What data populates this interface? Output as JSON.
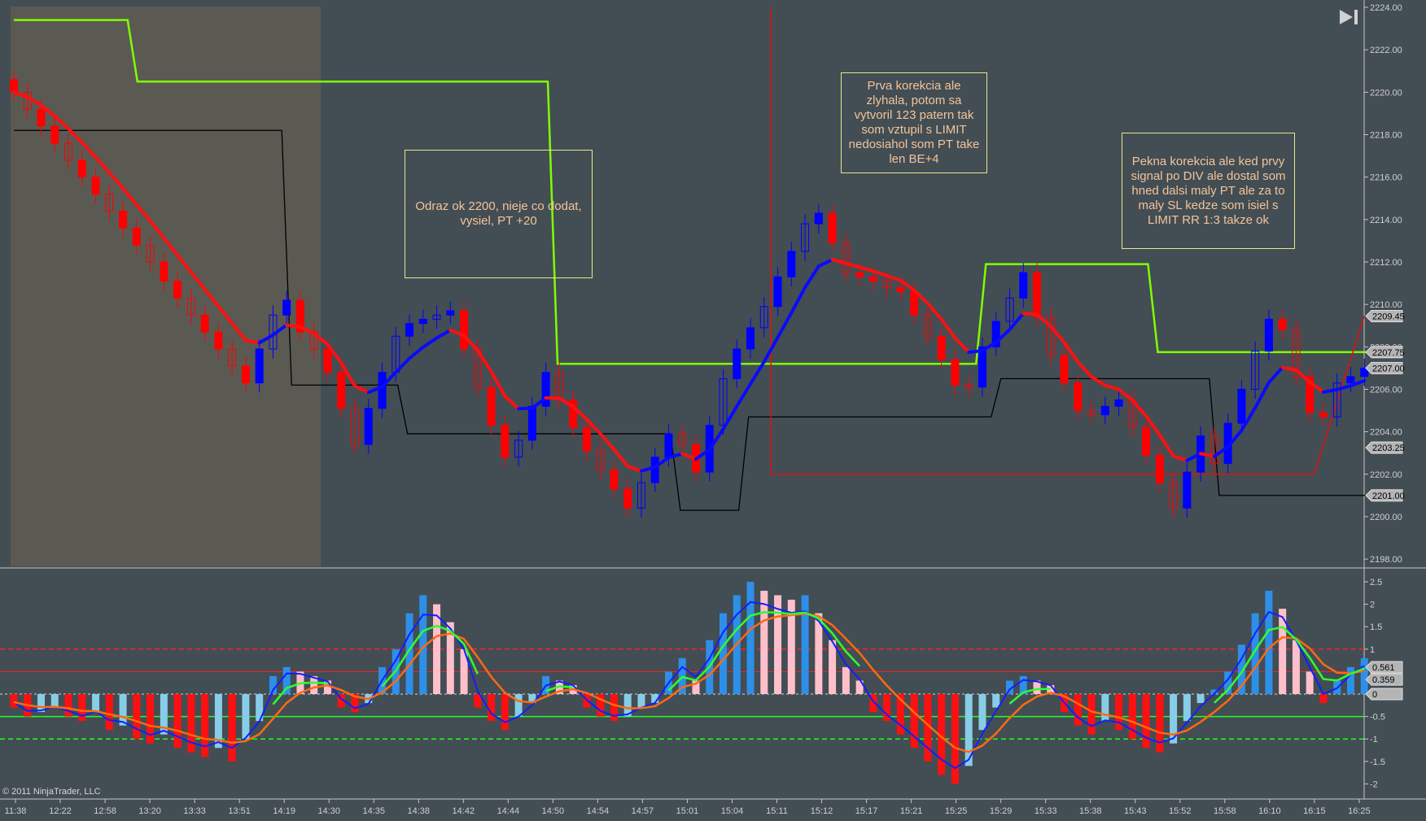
{
  "app": {
    "copyright": "© 2011 NinjaTrader, LLC",
    "skip_icon": "skip-to-end-icon"
  },
  "colors": {
    "background": "#434d54",
    "session_shade": "#5a5a53",
    "up_bar": "#0000ff",
    "down_bar": "#ff0000",
    "stop_line": "#7fff00",
    "note_text": "#f2c49a",
    "note_border": "#e6e88c"
  },
  "annotations": [
    {
      "text": "Odraz ok 2200, nieje co dodat, vysiel, PT +20"
    },
    {
      "text": "Prva korekcia ale zlyhala, potom sa vytvoril 123 patern tak som vztupil s LIMIT nedosiahol som PT take len BE+4"
    },
    {
      "text": "Pekna korekcia ale ked prvy signal po DIV ale dostal som hned dalsi maly PT ale za to maly SL kedze som isiel s LIMIT RR 1:3 takze ok"
    }
  ],
  "chart_data": [
    {
      "type": "candlestick",
      "ylim": [
        2198,
        2224
      ],
      "y_ticks": [
        "2224.00",
        "2222.00",
        "2220.00",
        "2218.00",
        "2216.00",
        "2214.00",
        "2212.00",
        "2210.00",
        "2208.00",
        "2206.00",
        "2204.00",
        "2202.00",
        "2200.00",
        "2198.00"
      ],
      "x_ticks": [
        "11:38",
        "12:22",
        "12:58",
        "13:20",
        "13:33",
        "13:51",
        "14:19",
        "14:30",
        "14:35",
        "14:38",
        "14:42",
        "14:44",
        "14:50",
        "14:54",
        "14:57",
        "15:01",
        "15:04",
        "15:11",
        "15:12",
        "15:17",
        "15:21",
        "15:25",
        "15:29",
        "15:33",
        "15:38",
        "15:43",
        "15:52",
        "15:58",
        "16:10",
        "16:15",
        "16:25"
      ],
      "price_badges": [
        "2209.45",
        "2207.75",
        "2207.00",
        "2203.25",
        "2201.00"
      ],
      "closes": [
        2220,
        2219.2,
        2218.4,
        2217.6,
        2216.8,
        2216.0,
        2215.2,
        2214.4,
        2213.6,
        2212.8,
        2212.0,
        2211.1,
        2210.3,
        2209.5,
        2208.7,
        2207.9,
        2207.1,
        2206.3,
        2207.9,
        2209.5,
        2210.2,
        2208.7,
        2207.9,
        2206.8,
        2205.1,
        2203.4,
        2205.1,
        2206.8,
        2208.5,
        2209.1,
        2209.3,
        2209.5,
        2209.7,
        2207.9,
        2206.1,
        2204.3,
        2202.8,
        2203.6,
        2205.2,
        2206.8,
        2205.5,
        2204.2,
        2203.1,
        2202.2,
        2201.3,
        2200.4,
        2201.6,
        2202.8,
        2203.9,
        2203.4,
        2202.1,
        2204.3,
        2206.5,
        2207.9,
        2208.9,
        2209.9,
        2211.3,
        2212.5,
        2213.8,
        2214.3,
        2212.9,
        2211.5,
        2211.3,
        2211.1,
        2210.8,
        2210.6,
        2209.5,
        2208.5,
        2207.4,
        2206.2,
        2206.1,
        2208.0,
        2209.2,
        2210.3,
        2211.5,
        2209.4,
        2207.6,
        2206.3,
        2205.0,
        2204.8,
        2205.2,
        2205.5,
        2204.2,
        2202.9,
        2201.6,
        2200.4,
        2202.1,
        2203.8,
        2202.5,
        2204.4,
        2206.0,
        2207.8,
        2209.3,
        2208.8,
        2206.6,
        2204.9,
        2204.7,
        2206.3,
        2206.6,
        2207.0
      ],
      "stop_steps": [
        [
          0,
          2223.4
        ],
        [
          8.7,
          2220.5
        ],
        [
          39.5,
          2207.2
        ],
        [
          70.9,
          2211.9
        ],
        [
          83.5,
          2207.75
        ],
        [
          99,
          2207.75
        ]
      ],
      "channel_steps": [
        [
          0,
          2218.2
        ],
        [
          20,
          2206.2
        ],
        [
          28.5,
          2203.9
        ],
        [
          48.5,
          2200.3
        ],
        [
          53.5,
          2204.7
        ],
        [
          72,
          2206.5
        ],
        [
          88,
          2201.0
        ],
        [
          99,
          2201.0
        ]
      ],
      "trade_line": [
        [
          55.5,
          2224
        ],
        [
          55.5,
          2202
        ],
        [
          95.3,
          2202
        ],
        [
          99,
          2209.45
        ]
      ],
      "session_shade_bars": [
        0,
        22.5
      ]
    },
    {
      "type": "bar",
      "ylim": [
        -2.1,
        2.6
      ],
      "y_ticks": [
        "2.5",
        "2",
        "1.5",
        "1",
        "0.5",
        "0",
        "-0.5",
        "-1",
        "-1.5",
        "-2"
      ],
      "levels": {
        "upper_dashed": 1,
        "upper": 0.5,
        "lower": -0.5,
        "lower_dashed": -1
      },
      "value_badges": [
        "0.561",
        "0.359",
        "0"
      ],
      "histogram": [
        -0.3,
        -0.5,
        -0.4,
        -0.3,
        -0.5,
        -0.6,
        -0.4,
        -0.8,
        -0.7,
        -1.0,
        -1.1,
        -0.9,
        -1.2,
        -1.3,
        -1.4,
        -1.2,
        -1.5,
        -1.0,
        -0.6,
        0.4,
        0.6,
        0.5,
        0.4,
        0.3,
        -0.3,
        -0.4,
        -0.2,
        0.6,
        1.0,
        1.8,
        2.2,
        2.0,
        1.6,
        1.0,
        -0.3,
        -0.6,
        -0.8,
        -0.5,
        -0.2,
        0.4,
        0.3,
        0.2,
        -0.3,
        -0.5,
        -0.6,
        -0.5,
        -0.3,
        -0.2,
        0.5,
        0.8,
        0.3,
        1.2,
        1.8,
        2.2,
        2.5,
        2.3,
        2.2,
        2.1,
        2.2,
        1.8,
        1.2,
        0.6,
        0.3,
        -0.4,
        -0.6,
        -0.9,
        -1.2,
        -1.5,
        -1.8,
        -2.0,
        -1.6,
        -0.8,
        -0.3,
        0.3,
        0.4,
        0.3,
        0.2,
        -0.4,
        -0.7,
        -0.9,
        -0.6,
        -0.8,
        -1.0,
        -1.2,
        -1.3,
        -1.1,
        -0.6,
        -0.2,
        0.1,
        0.5,
        1.1,
        1.8,
        2.3,
        1.9,
        1.2,
        0.5,
        -0.2,
        0.3,
        0.6,
        0.8
      ]
    }
  ]
}
